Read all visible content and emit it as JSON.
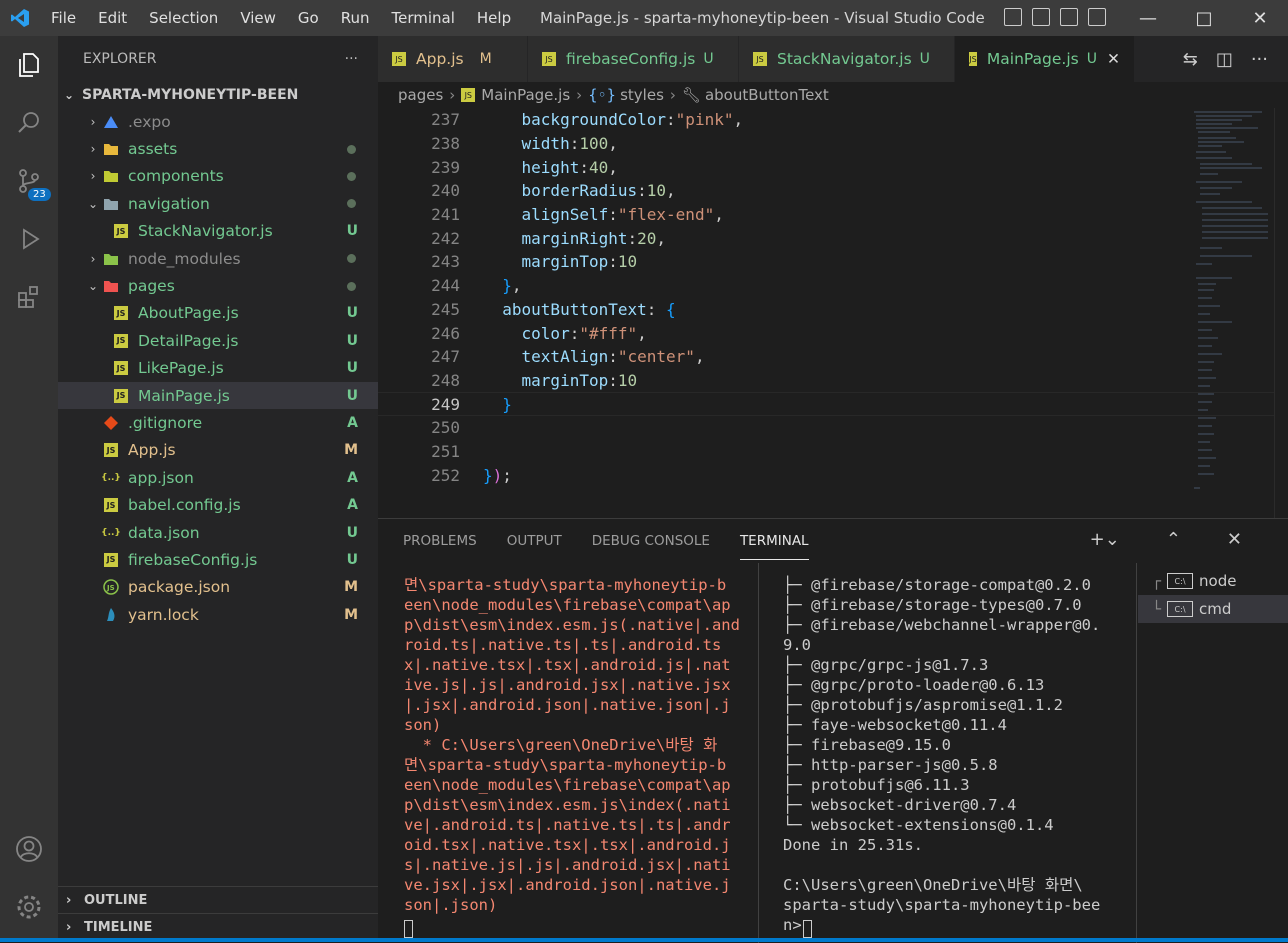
{
  "titlebar": {
    "menu": [
      "File",
      "Edit",
      "Selection",
      "View",
      "Go",
      "Run",
      "Terminal",
      "Help"
    ],
    "title": "MainPage.js - sparta-myhoneytip-been - Visual Studio Code"
  },
  "activity": {
    "scm_badge": "23"
  },
  "explorer": {
    "header": "EXPLORER",
    "root": "SPARTA-MYHONEYTIP-BEEN",
    "items": [
      {
        "label": ".expo",
        "status": ""
      },
      {
        "label": "assets",
        "status": "dot"
      },
      {
        "label": "components",
        "status": "dot"
      },
      {
        "label": "navigation",
        "status": "dot"
      },
      {
        "label": "StackNavigator.js",
        "status": "U"
      },
      {
        "label": "node_modules",
        "status": "dot"
      },
      {
        "label": "pages",
        "status": "dot"
      },
      {
        "label": "AboutPage.js",
        "status": "U"
      },
      {
        "label": "DetailPage.js",
        "status": "U"
      },
      {
        "label": "LikePage.js",
        "status": "U"
      },
      {
        "label": "MainPage.js",
        "status": "U"
      },
      {
        "label": ".gitignore",
        "status": "A"
      },
      {
        "label": "App.js",
        "status": "M"
      },
      {
        "label": "app.json",
        "status": "A"
      },
      {
        "label": "babel.config.js",
        "status": "A"
      },
      {
        "label": "data.json",
        "status": "U"
      },
      {
        "label": "firebaseConfig.js",
        "status": "U"
      },
      {
        "label": "package.json",
        "status": "M"
      },
      {
        "label": "yarn.lock",
        "status": "M"
      }
    ],
    "outline": "OUTLINE",
    "timeline": "TIMELINE"
  },
  "tabs": [
    {
      "label": "App.js",
      "status": "M"
    },
    {
      "label": "firebaseConfig.js",
      "status": "U"
    },
    {
      "label": "StackNavigator.js",
      "status": "U"
    },
    {
      "label": "MainPage.js",
      "status": "U",
      "close": "✕"
    }
  ],
  "breadcrumb": [
    "pages",
    "MainPage.js",
    "styles",
    "aboutButtonText"
  ],
  "editor": {
    "lines": [
      {
        "num": "237",
        "code": "    backgroundColor:\"pink\","
      },
      {
        "num": "238",
        "code": "    width:100,"
      },
      {
        "num": "239",
        "code": "    height:40,"
      },
      {
        "num": "240",
        "code": "    borderRadius:10,"
      },
      {
        "num": "241",
        "code": "    alignSelf:\"flex-end\","
      },
      {
        "num": "242",
        "code": "    marginRight:20,"
      },
      {
        "num": "243",
        "code": "    marginTop:10"
      },
      {
        "num": "244",
        "code": "  },"
      },
      {
        "num": "245",
        "code": "  aboutButtonText: {"
      },
      {
        "num": "246",
        "code": "    color:\"#fff\","
      },
      {
        "num": "247",
        "code": "    textAlign:\"center\","
      },
      {
        "num": "248",
        "code": "    marginTop:10"
      },
      {
        "num": "249",
        "code": "  }"
      },
      {
        "num": "250",
        "code": ""
      },
      {
        "num": "251",
        "code": ""
      },
      {
        "num": "252",
        "code": "});"
      }
    ]
  },
  "panel": {
    "tabs": [
      "PROBLEMS",
      "OUTPUT",
      "DEBUG CONSOLE",
      "TERMINAL"
    ],
    "terminal_left": "면\\sparta-study\\sparta-myhoneytip-b\neen\\node_modules\\firebase\\compat\\ap\np\\dist\\esm\\index.esm.js(.native|.and\nroid.ts|.native.ts|.ts|.android.ts\nx|.native.tsx|.tsx|.android.js|.nat\nive.js|.js|.android.jsx|.native.jsx\n|.jsx|.android.json|.native.json|.j\nson)\n  * C:\\Users\\green\\OneDrive\\바탕 화\n면\\sparta-study\\sparta-myhoneytip-b\neen\\node_modules\\firebase\\compat\\ap\np\\dist\\esm\\index.esm.js\\index(.nati\nve|.android.ts|.native.ts|.ts|.andr\noid.tsx|.native.tsx|.tsx|.android.j\ns|.native.js|.js|.android.jsx|.nati\nve.jsx|.jsx|.android.json|.native.j\nson|.json)",
    "terminal_right": "├─ @firebase/storage-compat@0.2.0\n├─ @firebase/storage-types@0.7.0\n├─ @firebase/webchannel-wrapper@0.\n9.0\n├─ @grpc/grpc-js@1.7.3\n├─ @grpc/proto-loader@0.6.13\n├─ @protobufjs/aspromise@1.1.2\n├─ faye-websocket@0.11.4\n├─ firebase@9.15.0\n├─ http-parser-js@0.5.8\n├─ protobufjs@6.11.3\n├─ websocket-driver@0.7.4\n└─ websocket-extensions@0.1.4\nDone in 25.31s.\n\nC:\\Users\\green\\OneDrive\\바탕 화면\\\nsparta-study\\sparta-myhoneytip-bee\nn>",
    "sessions": [
      "node",
      "cmd"
    ]
  }
}
